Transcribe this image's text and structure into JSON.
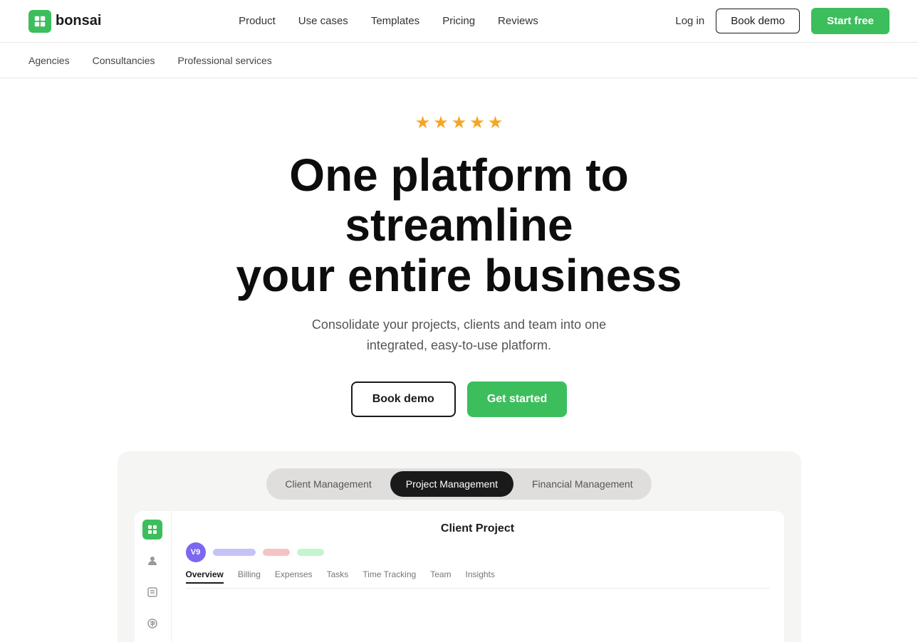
{
  "logo": {
    "text": "bonsai"
  },
  "nav": {
    "links": [
      {
        "label": "Product",
        "id": "product"
      },
      {
        "label": "Use cases",
        "id": "use-cases"
      },
      {
        "label": "Templates",
        "id": "templates"
      },
      {
        "label": "Pricing",
        "id": "pricing"
      },
      {
        "label": "Reviews",
        "id": "reviews"
      }
    ],
    "login": "Log in",
    "book_demo": "Book demo",
    "start_free": "Start free"
  },
  "secondary_nav": {
    "links": [
      {
        "label": "Agencies"
      },
      {
        "label": "Consultancies"
      },
      {
        "label": "Professional services"
      }
    ]
  },
  "hero": {
    "stars": 5,
    "title_line1": "One platform to streamline",
    "title_line2": "your entire business",
    "subtitle": "Consolidate your projects, clients and team into one integrated, easy-to-use platform.",
    "btn_demo": "Book demo",
    "btn_start": "Get started"
  },
  "demo": {
    "tabs": [
      {
        "label": "Client Management",
        "active": false
      },
      {
        "label": "Project Management",
        "active": true
      },
      {
        "label": "Financial Management",
        "active": false
      }
    ],
    "app": {
      "project_title": "Client Project",
      "nav_tabs": [
        {
          "label": "Overview",
          "active": true
        },
        {
          "label": "Billing",
          "active": false
        },
        {
          "label": "Expenses",
          "active": false
        },
        {
          "label": "Tasks",
          "active": false
        },
        {
          "label": "Time Tracking",
          "active": false
        },
        {
          "label": "Team",
          "active": false
        },
        {
          "label": "Insights",
          "active": false
        }
      ]
    }
  }
}
